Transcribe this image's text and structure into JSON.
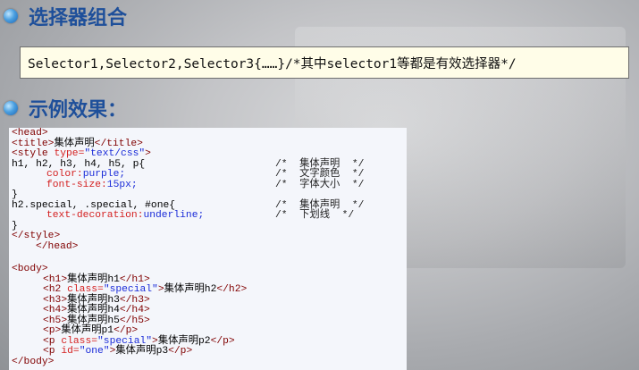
{
  "headings": {
    "selector_group": "选择器组合",
    "example": "示例效果："
  },
  "selector_line": "Selector1,Selector2,Selector3{……}/*其中selector1等都是有效选择器*/",
  "code": {
    "head_open": "<head>",
    "title_open": "<title>",
    "title_text": "集体声明",
    "title_close": "</title>",
    "style_open_tag": "<style",
    "style_type_attr": " type=",
    "style_type_val": "\"text/css\"",
    "style_open_end": ">",
    "rule1_selector": "h1, h2, h3, h4, h5, p{",
    "rule1_comment": "/*  集体声明  */",
    "rule1_prop1": "color:",
    "rule1_val1": "purple;",
    "rule1_comment1": "/*  文字颜色  */",
    "rule1_prop2": "font-size:",
    "rule1_val2": "15px;",
    "rule1_comment2": "/*  字体大小  */",
    "rule1_close": "}",
    "rule2_selector": "h2.special, .special, #one{",
    "rule2_comment": "/*  集体声明  */",
    "rule2_prop": "text-decoration:",
    "rule2_val": "underline;",
    "rule2_comment2": "/*  下划线  */",
    "rule2_close": "}",
    "style_close": "</style>",
    "head_close": "</head>",
    "body_open": "<body>",
    "h1_open": "<h1>",
    "h1_text": "集体声明h1",
    "h1_close": "</h1>",
    "h2_open": "<h2 ",
    "h2_attr": "class=",
    "h2_val": "\"special\"",
    "h2_gt": ">",
    "h2_text": "集体声明h2",
    "h2_close": "</h2>",
    "h3_open": "<h3>",
    "h3_text": "集体声明h3",
    "h3_close": "</h3>",
    "h4_open": "<h4>",
    "h4_text": "集体声明h4",
    "h4_close": "</h4>",
    "h5_open": "<h5>",
    "h5_text": "集体声明h5",
    "h5_close": "</h5>",
    "p1_open": "<p>",
    "p1_text": "集体声明p1",
    "p1_close": "</p>",
    "p2_open": "<p ",
    "p2_attr": "class=",
    "p2_val": "\"special\"",
    "p2_gt": ">",
    "p2_text": "集体声明p2",
    "p2_close": "</p>",
    "p3_open": "<p ",
    "p3_attr": "id=",
    "p3_val": "\"one\"",
    "p3_gt": ">",
    "p3_text": "集体声明p3",
    "p3_close": "</p>",
    "body_close": "</body>"
  },
  "icons": {
    "bullet": "blue-sphere-bullet-icon"
  },
  "colors": {
    "heading": "#1e4f9a",
    "tag": "#800000",
    "attr": "#d42020",
    "value": "#1a2bd8",
    "box_bg": "#fffde8"
  }
}
